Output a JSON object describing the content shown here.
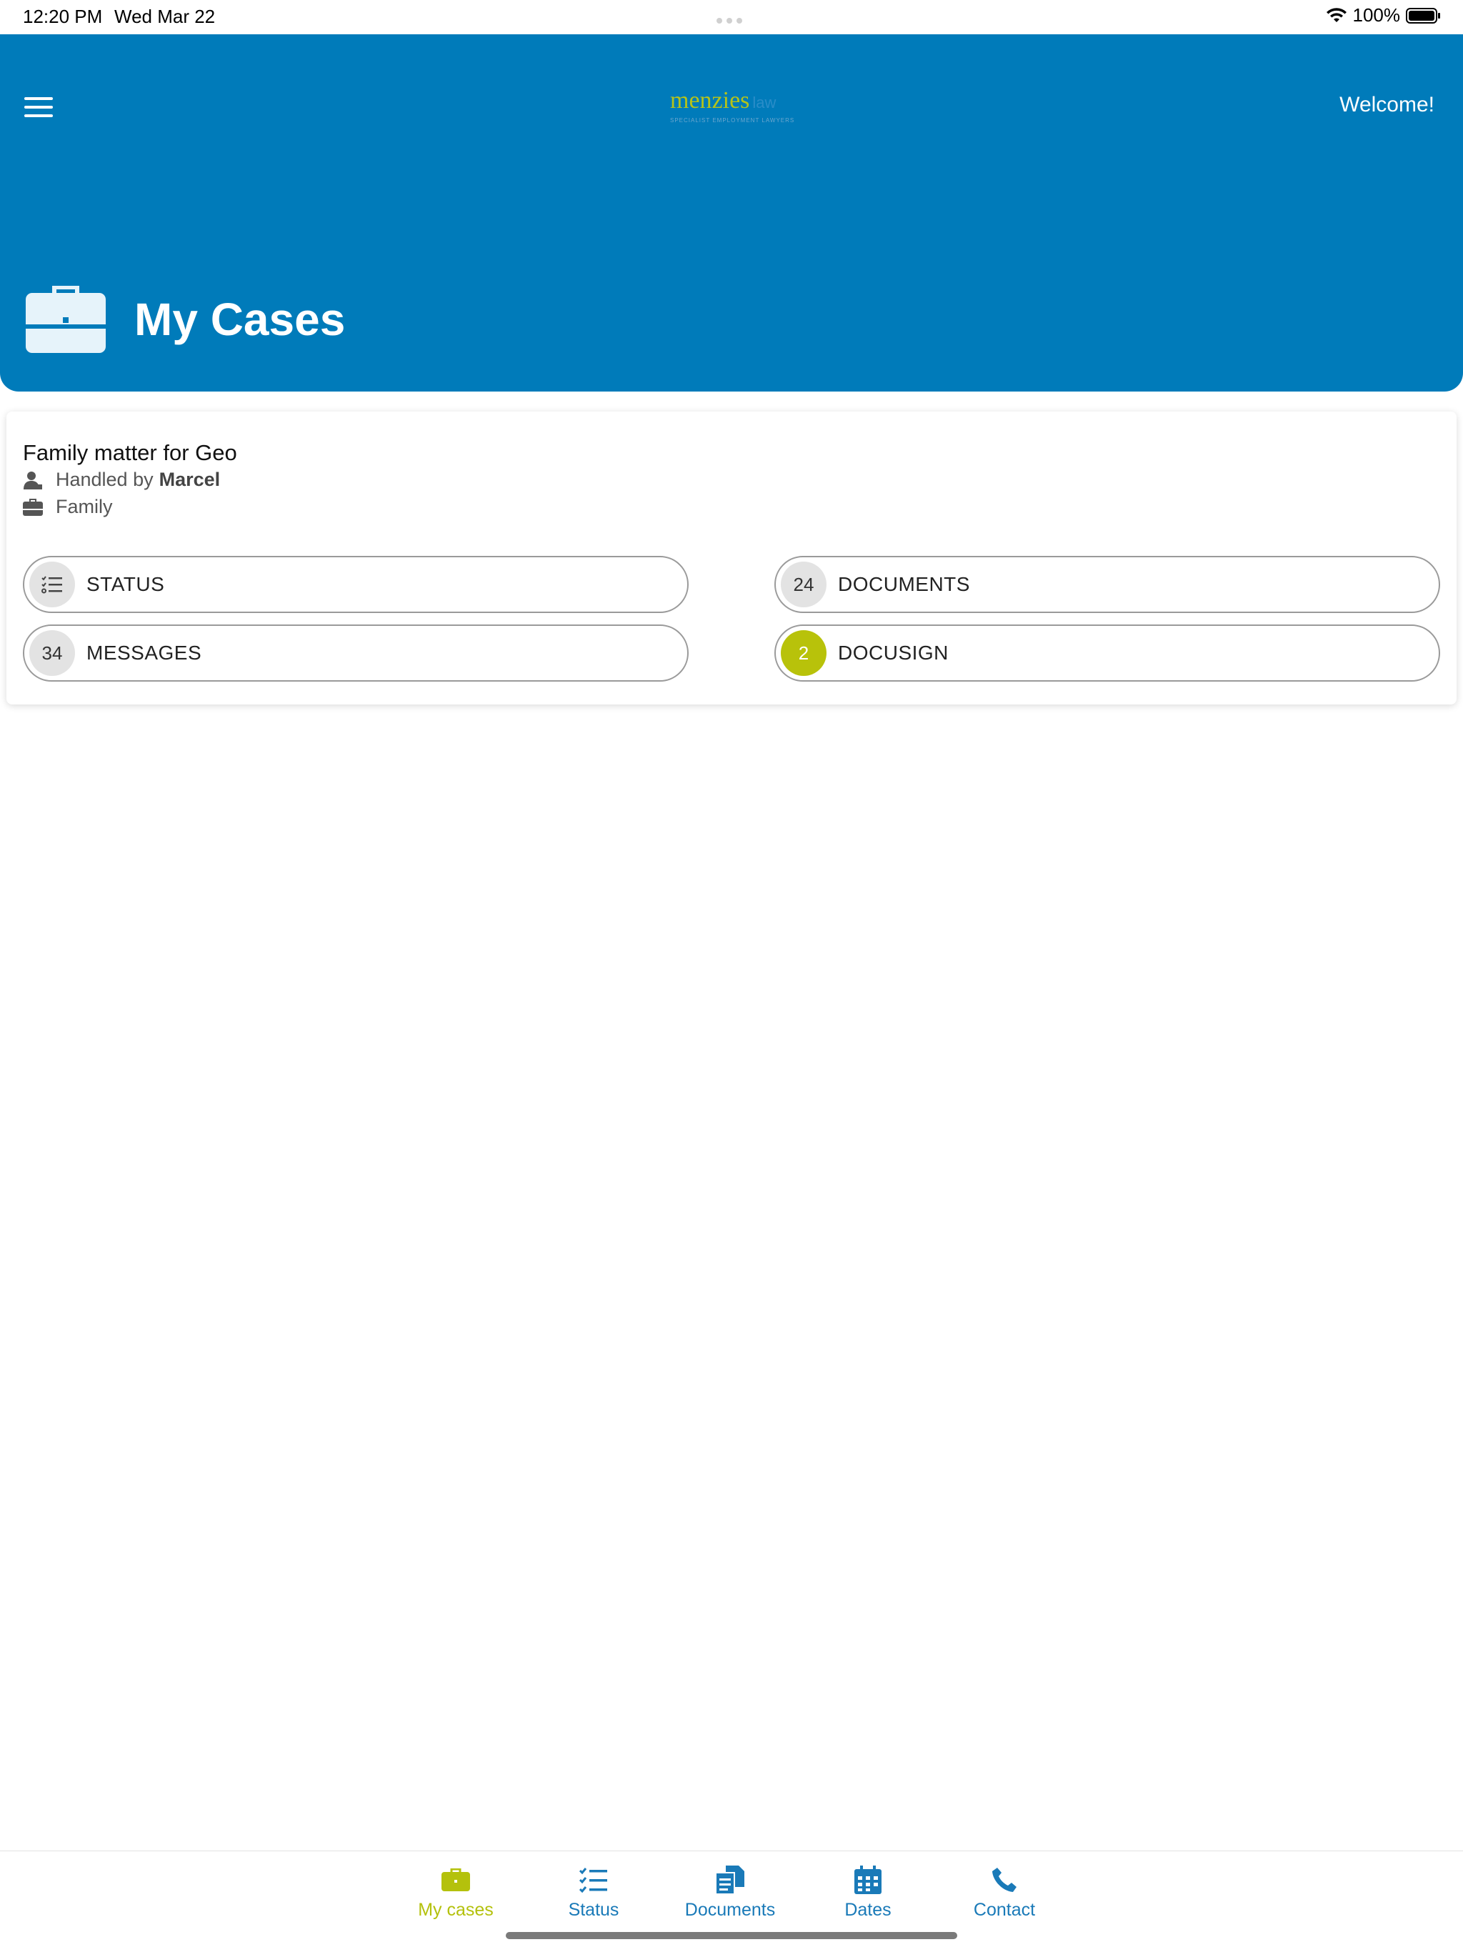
{
  "status_bar": {
    "time": "12:20 PM",
    "date": "Wed Mar 22",
    "battery": "100%"
  },
  "header": {
    "logo_text": "menzies",
    "logo_suffix": "law",
    "logo_tagline": "SPECIALIST EMPLOYMENT LAWYERS",
    "welcome": "Welcome!",
    "page_title": "My Cases",
    "background_color": "#007bba"
  },
  "case": {
    "title": "Family matter for Geo",
    "handled_by_prefix": "Handled by",
    "handler": "Marcel",
    "practice_area": "Family",
    "actions": [
      {
        "label": "STATUS",
        "badge": "",
        "badge_icon": "checklist-icon"
      },
      {
        "label": "DOCUMENTS",
        "badge": "24"
      },
      {
        "label": "MESSAGES",
        "badge": "34"
      },
      {
        "label": "DOCUSIGN",
        "badge": "2",
        "badge_color": "#b8c20a"
      }
    ]
  },
  "tabs": [
    {
      "label": "My cases",
      "icon": "briefcase-icon",
      "active": true
    },
    {
      "label": "Status",
      "icon": "checklist-icon",
      "active": false
    },
    {
      "label": "Documents",
      "icon": "documents-icon",
      "active": false
    },
    {
      "label": "Dates",
      "icon": "calendar-icon",
      "active": false
    },
    {
      "label": "Contact",
      "icon": "phone-icon",
      "active": false
    }
  ],
  "colors": {
    "accent": "#b4c10c",
    "primary": "#007bba"
  }
}
